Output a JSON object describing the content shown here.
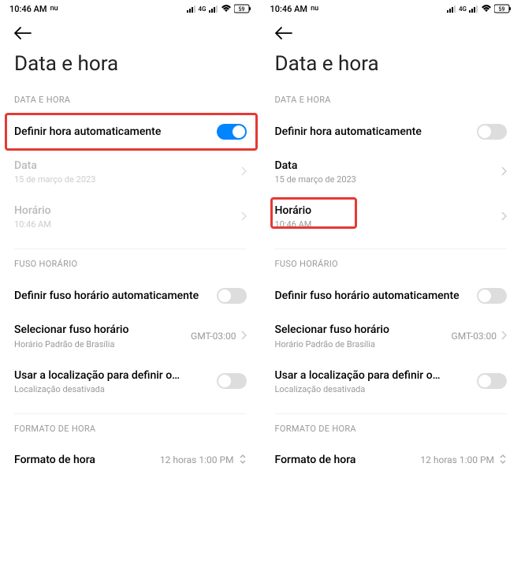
{
  "status": {
    "time": "10:46 AM",
    "carrier": "nu",
    "network": "4G",
    "battery": "59"
  },
  "page": {
    "title": "Data e hora"
  },
  "sections": {
    "data_hora": {
      "header": "DATA E HORA",
      "auto_time": "Definir hora automaticamente",
      "date_label": "Data",
      "date_value": "15 de março de 2023",
      "time_label": "Horário",
      "time_value": "10:46 AM"
    },
    "fuso": {
      "header": "FUSO HORÁRIO",
      "auto_tz": "Definir fuso horário automaticamente",
      "select_tz": "Selecionar fuso horário",
      "select_tz_sub": "Horário Padrão de Brasília",
      "select_tz_val": "GMT-03:00",
      "use_loc": "Usar a localização para definir o…",
      "use_loc_sub": "Localização desativada"
    },
    "formato": {
      "header": "FORMATO DE HORA",
      "format_label": "Formato de hora",
      "format_value": "12 horas 1:00 PM"
    }
  }
}
